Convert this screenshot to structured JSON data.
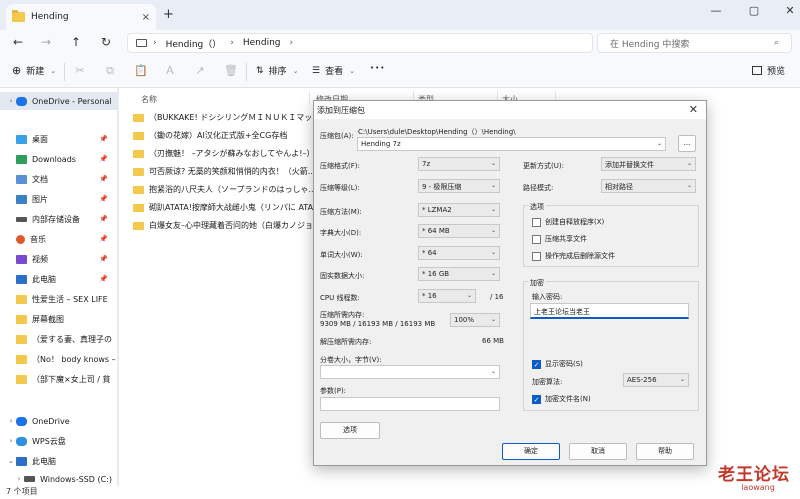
{
  "window": {
    "tab_title": "Hending",
    "tab_close": "×",
    "new_tab": "+",
    "controls": [
      "—",
      "▢",
      "✕"
    ]
  },
  "nav": {
    "back": "←",
    "forward": "→",
    "up": "↑",
    "refresh": "↻",
    "breadcrumb": [
      "Hending（）",
      "Hending"
    ],
    "breadcrumb_sep": "›",
    "breadcrumb_more": "›",
    "search_placeholder": "在 Hending 中搜索",
    "search_icon": "⌕"
  },
  "toolbar": {
    "new_label": "新建",
    "sort_label": "排序",
    "view_label": "查看",
    "more": "•••",
    "preview_label": "预览"
  },
  "sidebar": {
    "items": [
      {
        "label": "OneDrive - Personal",
        "icon": "cloud-icon",
        "chevron": "›",
        "selected": true
      },
      {
        "label": "桌面",
        "icon": "desktop-icon",
        "pin": true
      },
      {
        "label": "Downloads",
        "icon": "download-icon",
        "pin": true
      },
      {
        "label": "文档",
        "icon": "document-icon",
        "pin": true
      },
      {
        "label": "图片",
        "icon": "pictures-icon",
        "pin": true
      },
      {
        "label": "内部存储设备",
        "icon": "drive-icon",
        "pin": true
      },
      {
        "label": "音乐",
        "icon": "music-icon",
        "pin": true
      },
      {
        "label": "视频",
        "icon": "video-icon",
        "pin": true
      },
      {
        "label": "此电脑",
        "icon": "pc-icon",
        "pin": true
      },
      {
        "label": "性爱生活 – SEX LIFE",
        "icon": "folder-icon"
      },
      {
        "label": "屏幕截图",
        "icon": "folder-icon"
      },
      {
        "label": "（爱する妻、真理子の",
        "icon": "folder-icon"
      },
      {
        "label": "（No！ body knows –",
        "icon": "folder-icon"
      },
      {
        "label": "（部下魔×女上司 / 貧",
        "icon": "folder-icon"
      },
      {
        "label": "OneDrive",
        "icon": "cloud-icon",
        "chevron": "›"
      },
      {
        "label": "WPS云盘",
        "icon": "cloud-icon",
        "chevron": "›"
      },
      {
        "label": "此电脑",
        "icon": "pc-icon",
        "chevron": "⌄"
      },
      {
        "label": "Windows-SSD (C:)",
        "icon": "drive-icon",
        "chevron": "›"
      }
    ],
    "pin_glyph": "📌"
  },
  "columns": {
    "name": "名称",
    "modified": "修改日期",
    "type": "类型",
    "size": "大小"
  },
  "files": [
    "（BUKKAKE! ドシシリングＭＩＮＵＫＩマッ...",
    "（鋤の花嫁）AI汉化正式版+全CG存档",
    "（刃撫魅！ –アタシが蘇みなおしてやんよ!–）...",
    "可否厥谅? 无藁的笑颜和悄悄的内衣！（火箭...",
    "抱紧浴的八尺夫人（ソープランドのはっしゃ...",
    "砌趴ATATA!按摩師大战雌小鬼（リンパに ATA...",
    "白爆女友–心中理藏着否问的她（白爆カノジョ..."
  ],
  "status": "7 个项目",
  "dialog": {
    "title": "添加到压缩包",
    "close": "✕",
    "archive_label": "压缩包(A):",
    "archive_path": "C:\\Users\\dule\\Desktop\\Hending（）\\Hending\\",
    "archive_name": "Hending 7z",
    "browse": "...",
    "format_label": "压缩格式(F):",
    "format_value": "7z",
    "level_label": "压缩等级(L):",
    "level_value": "9 - 极限压缩",
    "method_label": "压缩方法(M):",
    "method_value": "* LZMA2",
    "dict_label": "字典大小(D):",
    "dict_value": "* 64 MB",
    "word_label": "单词大小(W):",
    "word_value": "* 64",
    "solid_label": "固实数据大小:",
    "solid_value": "* 16 GB",
    "threads_label": "CPU 线程数:",
    "threads_value": "* 16",
    "threads_total": "/ 16",
    "mem_label": "压缩所需内存:",
    "mem_value": "9309 MB / 16193 MB / 16193 MB",
    "mem_percent": "100%",
    "decomp_label": "解压缩所需内存:",
    "decomp_value": "66 MB",
    "split_label": "分卷大小，字节(V):",
    "params_label": "参数(P):",
    "options_button": "选项",
    "update_label": "更新方式(U):",
    "update_value": "添加并替换文件",
    "pathmode_label": "路径模式:",
    "pathmode_value": "相对路径",
    "options_group": "选项",
    "opt_sfx": "创建自释放程序(X)",
    "opt_shared": "压缩共享文件",
    "opt_delete": "操作完成后删除源文件",
    "enc_group": "加密",
    "password_label": "输入密码:",
    "password_value": "上老王论坛当老王",
    "show_password": "显示密码(S)",
    "enc_method_label": "加密算法:",
    "enc_method_value": "AES-256",
    "encrypt_names": "加密文件名(N)",
    "ok": "确定",
    "cancel": "取消",
    "help": "帮助",
    "dropdown_arrow": "⌄"
  },
  "watermark": {
    "big": "老王论坛",
    "small": "laowang"
  }
}
